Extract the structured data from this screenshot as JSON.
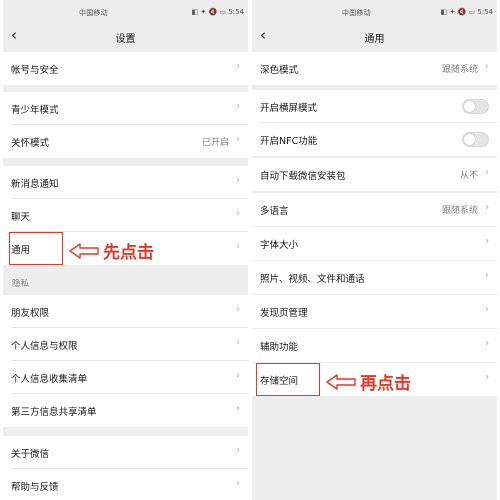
{
  "left": {
    "status": {
      "carrier": "中国移动",
      "icons": "◧ ✦ 🔇 ▭ 5:54",
      "time": "5:54"
    },
    "title": "设置",
    "groups": [
      {
        "items": [
          {
            "label": "帐号与安全",
            "value": ""
          }
        ]
      },
      {
        "items": [
          {
            "label": "青少年模式",
            "value": ""
          },
          {
            "label": "关怀模式",
            "value": "已开启"
          }
        ]
      },
      {
        "items": [
          {
            "label": "新消息通知",
            "value": ""
          },
          {
            "label": "聊天",
            "value": ""
          },
          {
            "label": "通用",
            "value": ""
          }
        ]
      }
    ],
    "section_privacy": "隐私",
    "privacy_items": [
      {
        "label": "朋友权限"
      },
      {
        "label": "个人信息与权限"
      },
      {
        "label": "个人信息收集清单"
      },
      {
        "label": "第三方信息共享清单"
      }
    ],
    "bottom_items": [
      {
        "label": "关于微信"
      },
      {
        "label": "帮助与反馈"
      }
    ],
    "callout": "先点击"
  },
  "right": {
    "status": {
      "carrier": "中国移动",
      "icons": "◧ ✦ 🔇 ▭ 5:54",
      "time": "5:54"
    },
    "title": "通用",
    "dark_mode": {
      "label": "深色模式",
      "value": "跟随系统"
    },
    "landscape": {
      "label": "开启横屏模式",
      "on": false
    },
    "nfc": {
      "label": "开启NFC功能",
      "on": false
    },
    "auto_download": {
      "label": "自动下载微信安装包",
      "value": "从不"
    },
    "language": {
      "label": "多语言",
      "value": "跟随系统"
    },
    "font_size": {
      "label": "字体大小"
    },
    "media": {
      "label": "照片、视频、文件和通话"
    },
    "discover": {
      "label": "发现页管理"
    },
    "assist": {
      "label": "辅助功能"
    },
    "storage": {
      "label": "存储空间"
    },
    "callout": "再点击"
  },
  "colors": {
    "highlight": "#e8362a",
    "background": "#ededed",
    "row": "#ffffff",
    "secondary_text": "#7f7f7f"
  }
}
